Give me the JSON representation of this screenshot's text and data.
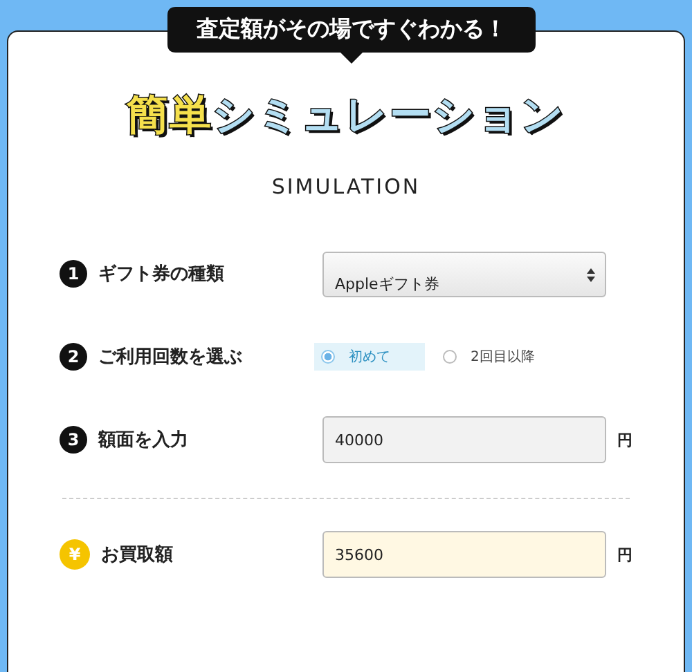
{
  "bubble": "査定額がその場ですぐわかる！",
  "title": [
    {
      "text": "簡単",
      "color": "#f5e04c"
    },
    {
      "text": "シミュレーション",
      "color": "#b3def2"
    }
  ],
  "subtitle": "SIMULATION",
  "rows": [
    {
      "kind": "select",
      "badge": "1",
      "label": "ギフト券の種類",
      "value": "Appleギフト券"
    },
    {
      "kind": "radio",
      "badge": "2",
      "label": "ご利用回数を選ぶ",
      "options": [
        {
          "label": "初めて",
          "selected": true
        },
        {
          "label": "2回目以降",
          "selected": false
        }
      ]
    },
    {
      "kind": "input",
      "badge": "3",
      "label": "額面を入力",
      "value": "40000",
      "unit": "円"
    },
    {
      "kind": "result",
      "badge": "¥",
      "label": "お買取額",
      "value": "35600",
      "unit": "円"
    }
  ]
}
